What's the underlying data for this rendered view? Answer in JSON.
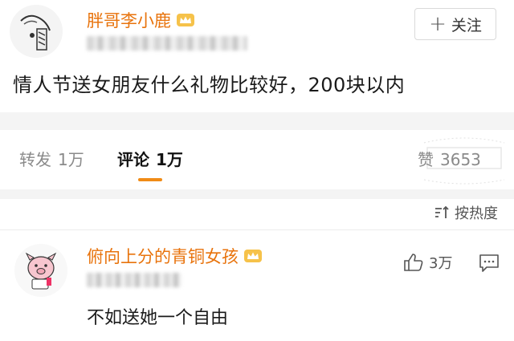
{
  "post": {
    "author_name": "胖哥李小鹿",
    "follow_label": "关注",
    "text": "情人节送女朋友什么礼物比较好，200块以内"
  },
  "stats": {
    "repost_label": "转发",
    "repost_count": "1万",
    "comment_label": "评论",
    "comment_count": "1万",
    "like_label": "赞",
    "like_count": "3653"
  },
  "sort": {
    "label": "按热度"
  },
  "comment": {
    "author_name": "俯向上分的青铜女孩",
    "text": "不如送她一个自由",
    "like_count": "3万"
  },
  "colors": {
    "username": "#e8730c",
    "tab_accent": "#f08b16",
    "band": "#f4f4f4"
  }
}
